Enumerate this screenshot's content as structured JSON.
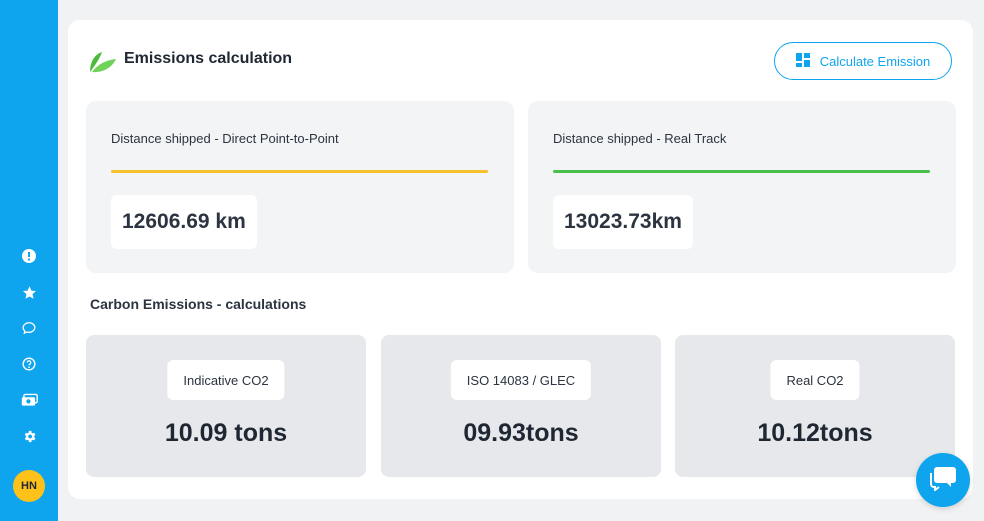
{
  "colors": {
    "sidebar": "#0ea5ee",
    "accent": "#0ea5ee",
    "avatar": "#ffc21a",
    "direct_line": "#f6c12d",
    "track_line": "#4ac04a",
    "leaf": "#4cbb3d"
  },
  "sidebar": {
    "items": [
      {
        "icon": "alert-icon"
      },
      {
        "icon": "star-icon"
      },
      {
        "icon": "chat-bubble-icon"
      },
      {
        "icon": "help-icon"
      },
      {
        "icon": "money-icon"
      },
      {
        "icon": "gear-icon"
      }
    ],
    "avatar_initials": "HN"
  },
  "header": {
    "title": "Emissions calculation",
    "button_label": "Calculate Emission"
  },
  "distance": {
    "direct": {
      "label": "Distance shipped - Direct Point-to-Point",
      "value": "12606.69 km"
    },
    "track": {
      "label": "Distance shipped - Real Track",
      "value": "13023.73km"
    }
  },
  "carbon": {
    "title": "Carbon Emissions - calculations",
    "cards": [
      {
        "label": "Indicative CO2",
        "value": "10.09 tons"
      },
      {
        "label": "ISO 14083 / GLEC",
        "value": "09.93tons"
      },
      {
        "label": "Real CO2",
        "value": "10.12tons"
      }
    ]
  }
}
